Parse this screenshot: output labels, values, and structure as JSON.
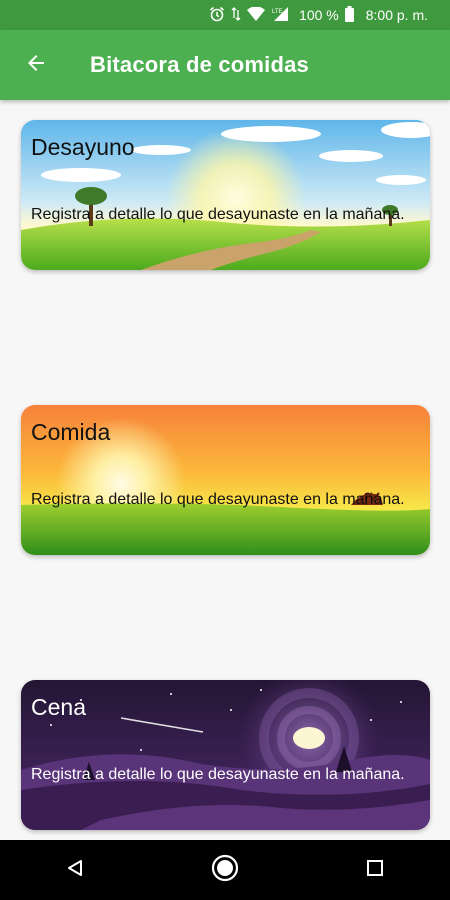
{
  "status_bar": {
    "battery_percent": "100 %",
    "time": "8:00 p. m.",
    "icons": [
      "alarm-icon",
      "data-arrows-icon",
      "wifi-icon",
      "signal-lte-icon",
      "battery-icon"
    ]
  },
  "app_bar": {
    "back_icon": "arrow-back-icon",
    "title": "Bitacora de comidas"
  },
  "cards": [
    {
      "title": "Desayuno",
      "description": "Registra a detalle lo que desayunaste en la mañana.",
      "theme": "morning-sky-meadow"
    },
    {
      "title": "Comida",
      "description": "Registra a detalle lo que desayunaste en la mañana.",
      "theme": "sunset-field"
    },
    {
      "title": "Cena",
      "description": "Registra a detalle lo que desayunaste en la mañana.",
      "theme": "night-moon"
    }
  ],
  "nav_bar": {
    "buttons": [
      "back-triangle-icon",
      "home-circle-icon",
      "recents-square-icon"
    ]
  },
  "colors": {
    "status_bar": "#3f9a3f",
    "app_bar": "#4caf50",
    "background": "#f7f7f7",
    "nav_bar": "#000000"
  }
}
